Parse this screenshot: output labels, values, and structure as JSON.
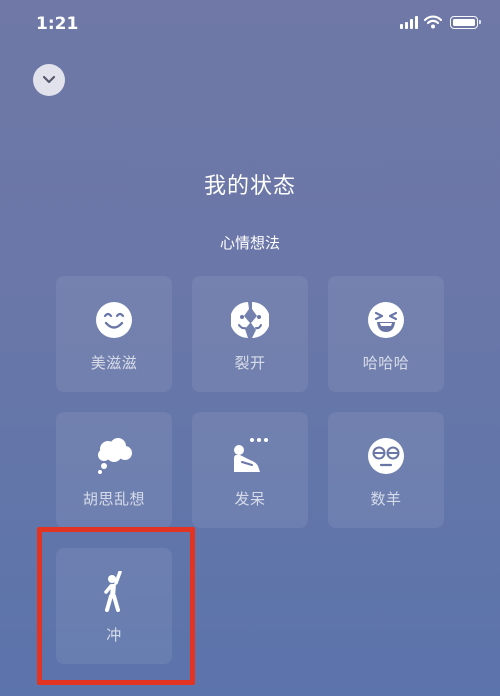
{
  "status_bar": {
    "time": "1:21",
    "icons": [
      "signal-icon",
      "wifi-icon",
      "battery-icon"
    ]
  },
  "header": {
    "collapse_icon": "chevron-down-icon"
  },
  "title": "我的状态",
  "subtitle": "心情想法",
  "moods": [
    {
      "label": "美滋滋",
      "icon": "smile-face-icon"
    },
    {
      "label": "裂开",
      "icon": "cracked-face-icon"
    },
    {
      "label": "哈哈哈",
      "icon": "laughing-face-icon"
    },
    {
      "label": "胡思乱想",
      "icon": "thought-cloud-icon"
    },
    {
      "label": "发呆",
      "icon": "daydream-person-icon"
    },
    {
      "label": "数羊",
      "icon": "sleepy-face-icon"
    },
    {
      "label": "冲",
      "icon": "cheering-person-icon"
    }
  ],
  "colors": {
    "highlight": "#e33322",
    "background_top": "#6f78a6",
    "background_bottom": "#5b74ab"
  }
}
